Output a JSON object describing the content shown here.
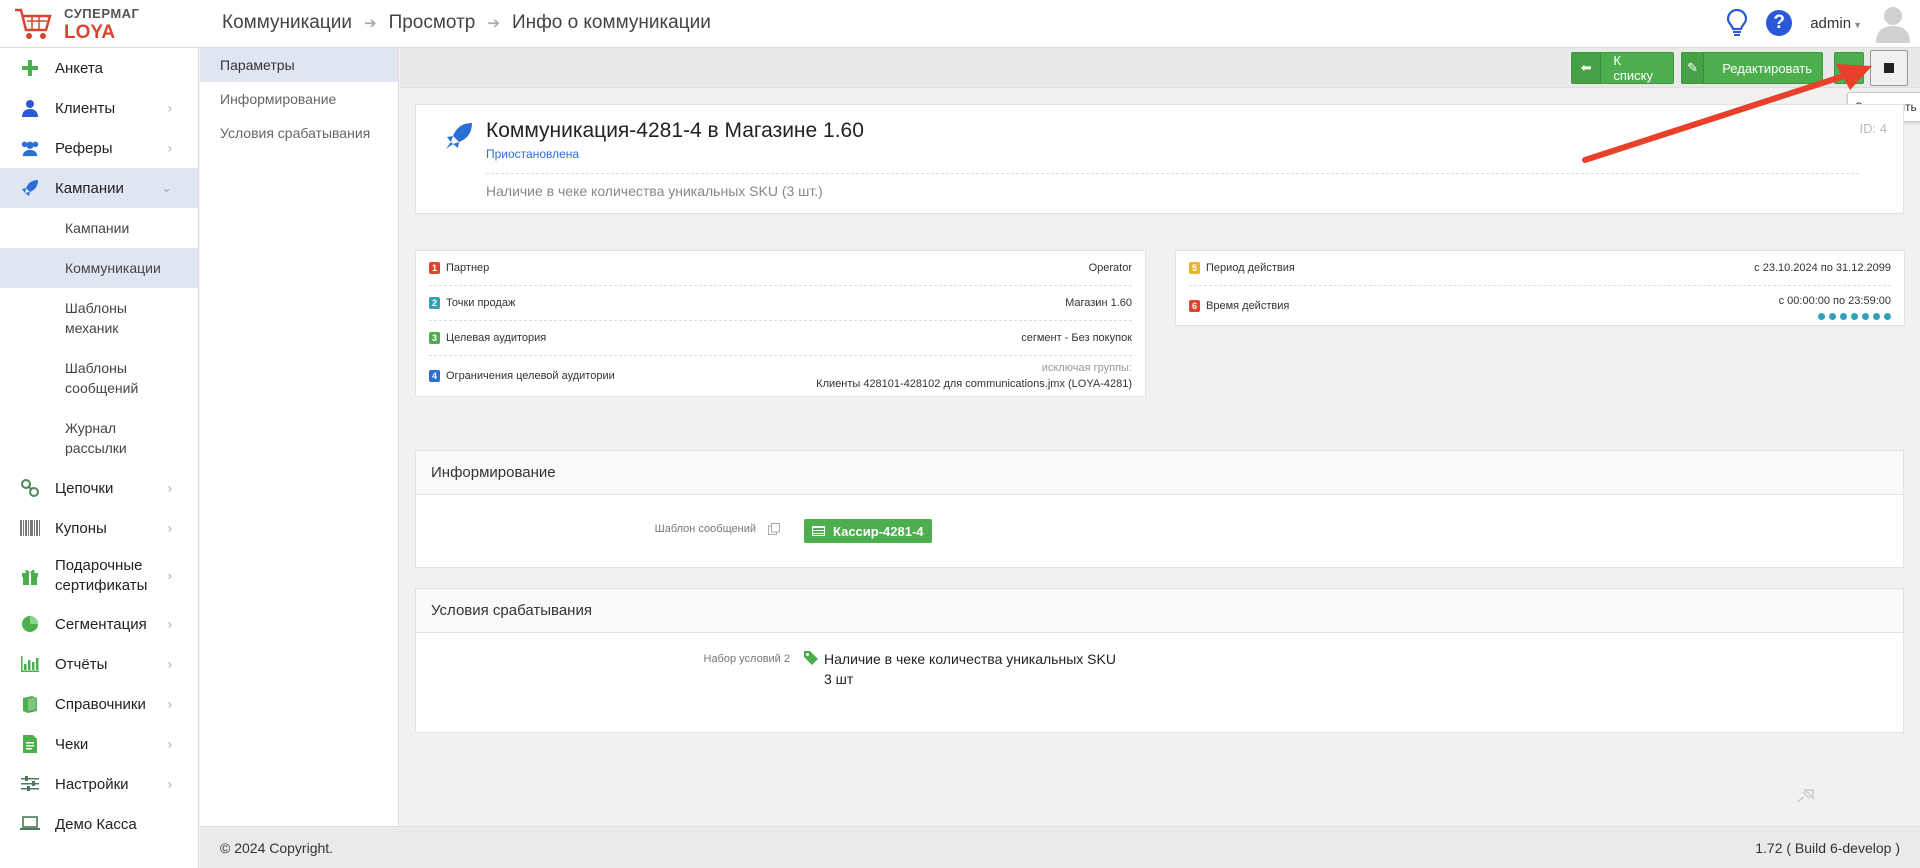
{
  "app": {
    "logo_line1": "СУПЕРМАГ",
    "logo_line2": "LOYA",
    "brand_color": "#d9452e",
    "accent_color": "#4cae4c"
  },
  "breadcrumb": [
    "Коммуникации",
    "Просмотр",
    "Инфо о коммуникации"
  ],
  "header": {
    "user": "admin",
    "help_label": "?"
  },
  "sidebar": {
    "items": [
      {
        "label": "Анкета",
        "icon": "plus-icon"
      },
      {
        "label": "Клиенты",
        "icon": "user-icon"
      },
      {
        "label": "Реферы",
        "icon": "users-icon"
      },
      {
        "label": "Кампании",
        "icon": "rocket-icon"
      },
      {
        "label": "Цепочки",
        "icon": "link-icon"
      },
      {
        "label": "Купоны",
        "icon": "barcode-icon"
      },
      {
        "label": "Подарочные сертификаты",
        "icon": "gift-icon"
      },
      {
        "label": "Сегментация",
        "icon": "pie-chart-icon"
      },
      {
        "label": "Отчёты",
        "icon": "bar-chart-icon"
      },
      {
        "label": "Справочники",
        "icon": "book-icon"
      },
      {
        "label": "Чеки",
        "icon": "receipt-icon"
      },
      {
        "label": "Настройки",
        "icon": "sliders-icon"
      },
      {
        "label": "Демо Касса",
        "icon": "laptop-icon"
      }
    ],
    "campaign_sub": [
      "Кампании",
      "Коммуникации",
      "Шаблоны механик",
      "Шаблоны сообщений",
      "Журнал рассылки"
    ]
  },
  "subnav": [
    "Параметры",
    "Информирование",
    "Условия срабатывания"
  ],
  "toolbar": {
    "back_label": "К списку",
    "edit_label": "Редактировать",
    "stop_tooltip": "Завершить"
  },
  "communication": {
    "title": "Коммуникация-4281-4 в Магазине 1.60",
    "status": "Приостановлена",
    "id_label": "ID: 4",
    "description": "Наличие в чеке количества уникальных SKU (3 шт.)"
  },
  "params": [
    {
      "num": "1",
      "label": "Партнер",
      "value": "Operator"
    },
    {
      "num": "2",
      "label": "Точки продаж",
      "value": "Магазин 1.60"
    },
    {
      "num": "3",
      "label": "Целевая аудитория",
      "value": "сегмент - Без покупок"
    },
    {
      "num": "4",
      "label": "Ограничения целевой аудитории",
      "value_note": "исключая группы:",
      "value": "Клиенты 428101-428102 для communications.jmx (LOYA-4281)"
    }
  ],
  "period": [
    {
      "num": "5",
      "label": "Период действия",
      "value": "с 23.10.2024 по 31.12.2099"
    },
    {
      "num": "6",
      "label": "Время действия",
      "value": "с 00:00:00 по 23:59:00",
      "weekday_dots": 7
    }
  ],
  "informing": {
    "title": "Информирование",
    "field_label": "Шаблон сообщений",
    "template": "Кассир-4281-4"
  },
  "conditions": {
    "title": "Условия срабатывания",
    "field_label": "Набор условий 2",
    "line1": "Наличие в чеке количества уникальных SKU",
    "line2": "3 шт"
  },
  "footer": {
    "copyright": "© 2024 Copyright.",
    "version": "1.72 ( Build 6-develop )"
  }
}
